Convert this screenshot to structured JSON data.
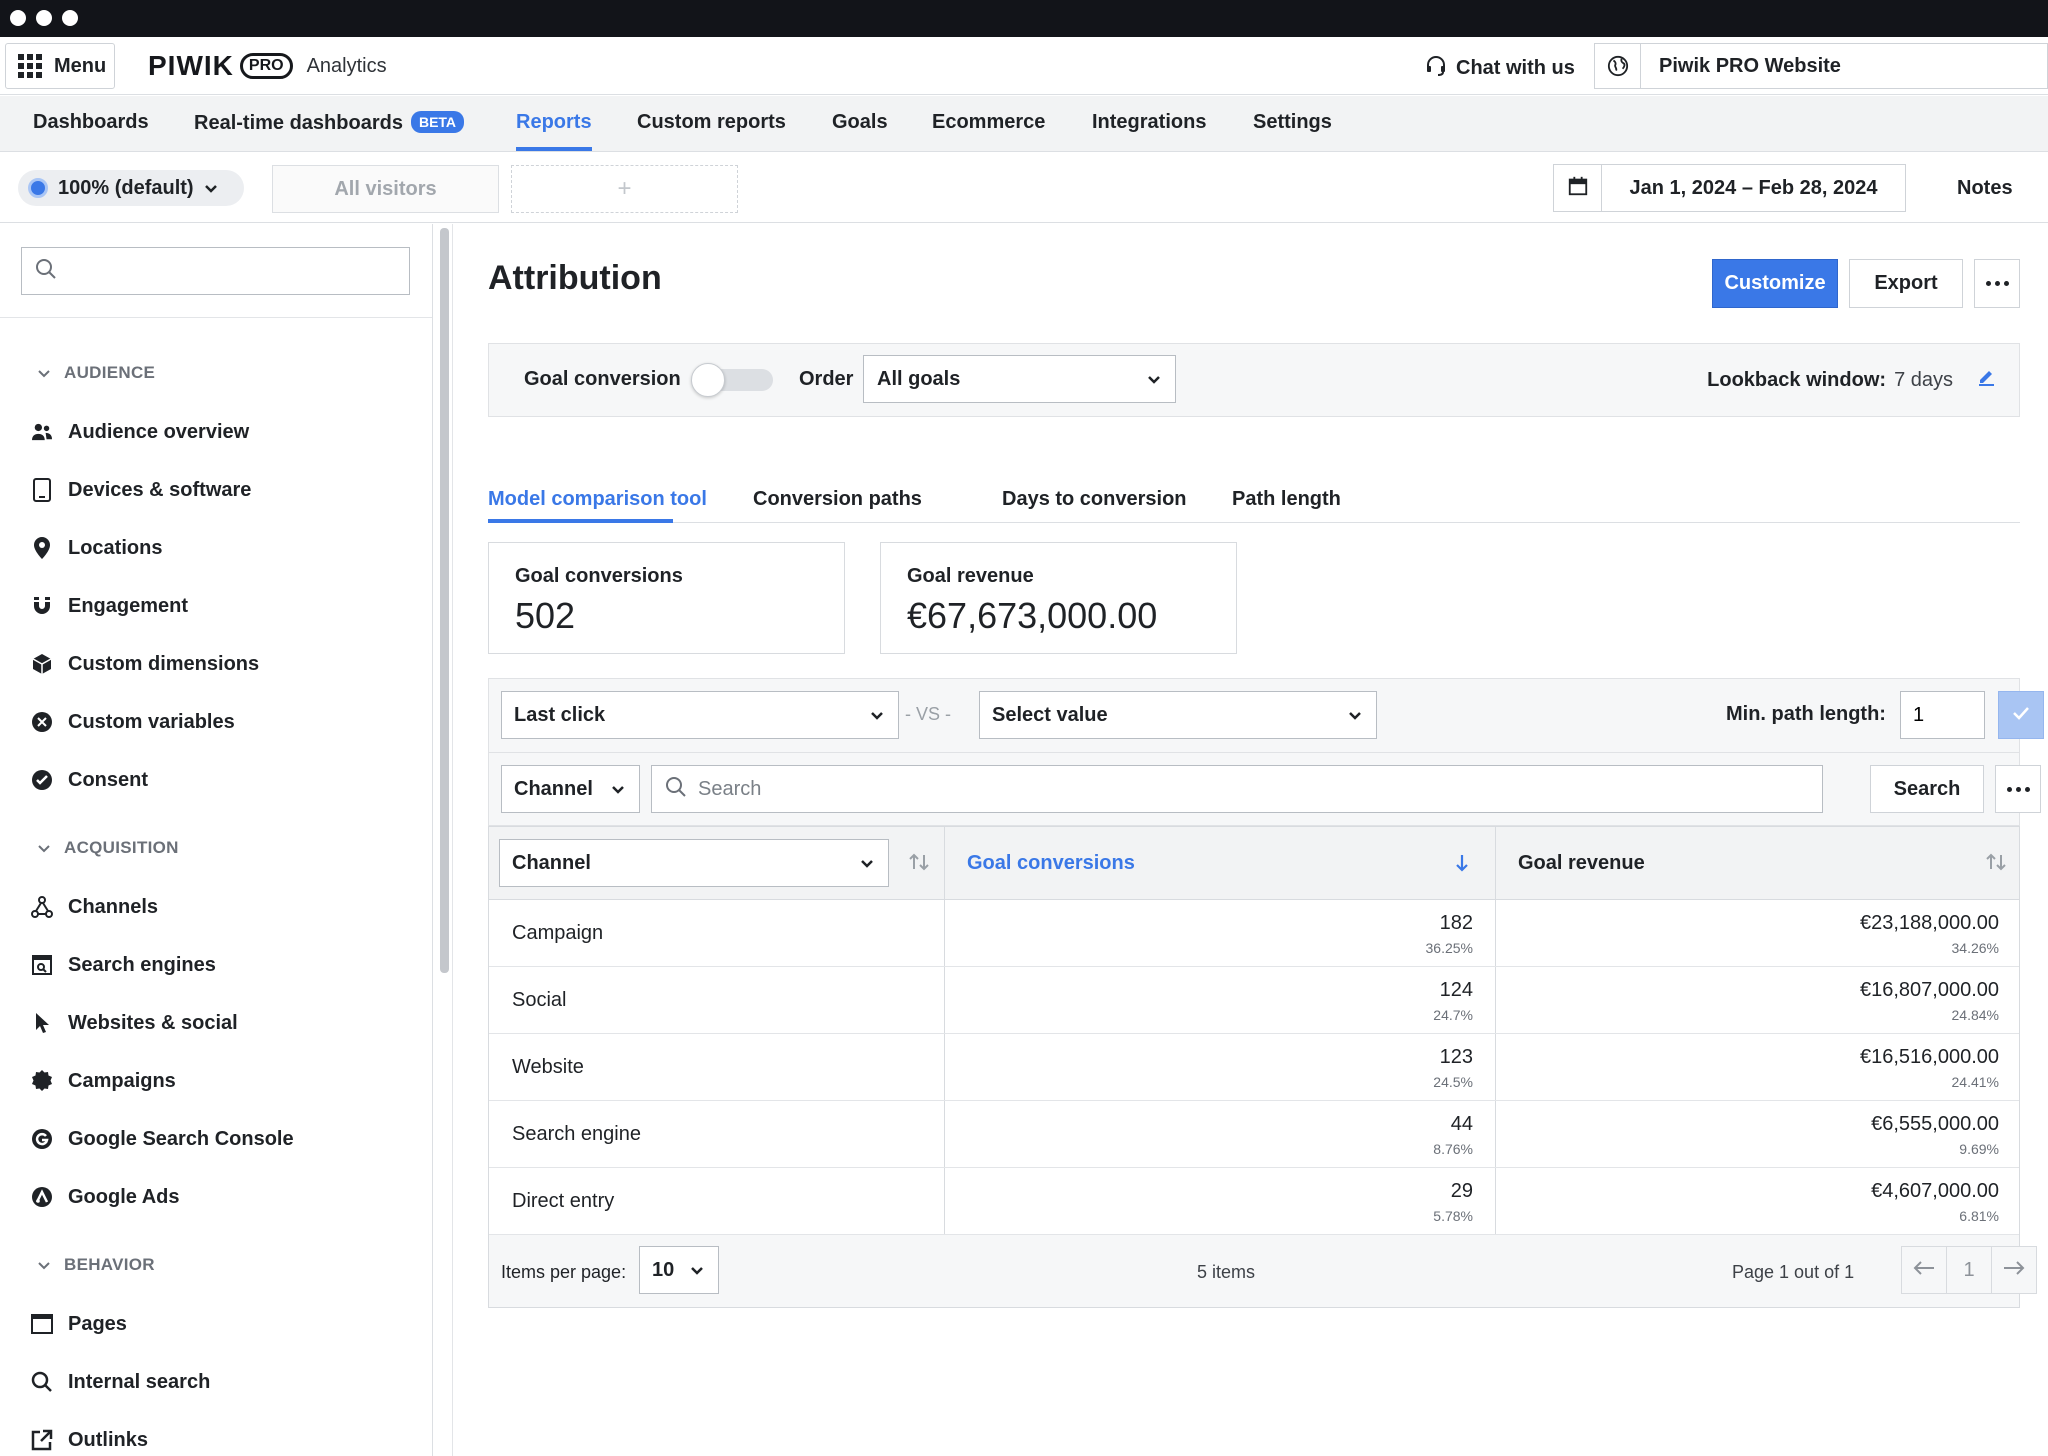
{
  "topbar": {
    "menu_label": "Menu",
    "logo_word": "PIWIK",
    "logo_pro": "PRO",
    "logo_product": "Analytics",
    "chat_label": "Chat with us",
    "site_name": "Piwik PRO Website"
  },
  "nav": {
    "items": [
      {
        "label": "Dashboards"
      },
      {
        "label": "Real-time dashboards",
        "badge": "BETA"
      },
      {
        "label": "Reports",
        "active": true
      },
      {
        "label": "Custom reports"
      },
      {
        "label": "Goals"
      },
      {
        "label": "Ecommerce"
      },
      {
        "label": "Integrations"
      },
      {
        "label": "Settings"
      }
    ]
  },
  "filterbar": {
    "sampling_label": "100% (default)",
    "segment_label": "All visitors",
    "segment_add": "+",
    "date_range": "Jan 1, 2024 – Feb 28, 2024",
    "notes_label": "Notes"
  },
  "sidebar": {
    "search_placeholder": "",
    "sections": [
      {
        "title": "AUDIENCE",
        "items": [
          "Audience overview",
          "Devices & software",
          "Locations",
          "Engagement",
          "Custom dimensions",
          "Custom variables",
          "Consent"
        ]
      },
      {
        "title": "ACQUISITION",
        "items": [
          "Channels",
          "Search engines",
          "Websites & social",
          "Campaigns",
          "Google Search Console",
          "Google Ads"
        ]
      },
      {
        "title": "BEHAVIOR",
        "items": [
          "Pages",
          "Internal search",
          "Outlinks"
        ]
      }
    ]
  },
  "page": {
    "title": "Attribution",
    "customize_label": "Customize",
    "export_label": "Export"
  },
  "goal_panel": {
    "goal_conversion_label": "Goal conversion",
    "order_label": "Order",
    "toggle_on": false,
    "goal_select_value": "All goals",
    "lookback_label": "Lookback window:",
    "lookback_value": "7 days"
  },
  "tabs": [
    {
      "label": "Model comparison tool",
      "active": true
    },
    {
      "label": "Conversion paths"
    },
    {
      "label": "Days to conversion"
    },
    {
      "label": "Path length"
    }
  ],
  "kpis": [
    {
      "label": "Goal conversions",
      "value": "502"
    },
    {
      "label": "Goal revenue",
      "value": "€67,673,000.00"
    }
  ],
  "compare": {
    "model_a": "Last click",
    "vs_label": "VS",
    "model_b": "Select value",
    "min_path_label": "Min. path length:",
    "min_path_value": "1"
  },
  "search": {
    "dimension": "Channel",
    "placeholder": "Search",
    "button_label": "Search"
  },
  "table": {
    "columns": [
      "Channel",
      "Goal conversions",
      "Goal revenue"
    ],
    "rows": [
      {
        "channel": "Campaign",
        "conversions": "182",
        "conversions_pct": "36.25%",
        "revenue": "€23,188,000.00",
        "revenue_pct": "34.26%"
      },
      {
        "channel": "Social",
        "conversions": "124",
        "conversions_pct": "24.7%",
        "revenue": "€16,807,000.00",
        "revenue_pct": "24.84%"
      },
      {
        "channel": "Website",
        "conversions": "123",
        "conversions_pct": "24.5%",
        "revenue": "€16,516,000.00",
        "revenue_pct": "24.41%"
      },
      {
        "channel": "Search engine",
        "conversions": "44",
        "conversions_pct": "8.76%",
        "revenue": "€6,555,000.00",
        "revenue_pct": "9.69%"
      },
      {
        "channel": "Direct entry",
        "conversions": "29",
        "conversions_pct": "5.78%",
        "revenue": "€4,607,000.00",
        "revenue_pct": "6.81%"
      }
    ],
    "footer": {
      "items_per_page_label": "Items per page:",
      "items_per_page": "10",
      "items_count": "5 items",
      "page_info": "Page 1 out of 1",
      "current_page": "1"
    }
  },
  "colors": {
    "accent": "#3a78e7",
    "titlebar": "#121419",
    "nav_bg": "#f2f3f4"
  }
}
